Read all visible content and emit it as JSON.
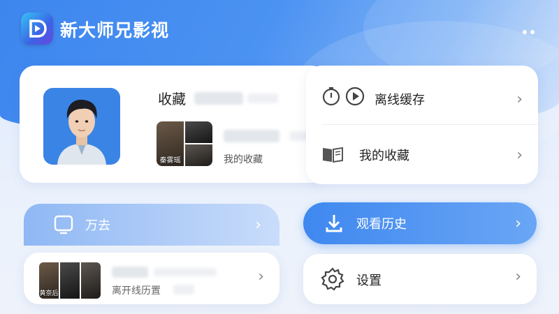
{
  "app": {
    "title": "新大师兄影视",
    "logo_icon": "play-logo-icon",
    "more_icon": "more-dots-icon"
  },
  "profile": {
    "favorites_title": "收藏",
    "thumb_caption": "秦雾瑶",
    "favorites_subtitle": "我的收藏"
  },
  "menu": {
    "offline": {
      "label": "离线缓存",
      "icon": "timer-play-icon"
    },
    "my_favorites": {
      "label": "我的收藏",
      "icon": "book-icon"
    }
  },
  "pill_left": {
    "label": "万去",
    "icon": "tv-icon"
  },
  "pill_right": {
    "label": "观看历史",
    "icon": "download-icon"
  },
  "history": {
    "thumb_caption": "黄奈后",
    "subtitle": "离开线历置"
  },
  "settings": {
    "label": "设置",
    "icon": "gear-icon"
  },
  "chevron": "›",
  "colors": {
    "accent": "#3f88ef",
    "header_bg": "#4b92f2"
  }
}
